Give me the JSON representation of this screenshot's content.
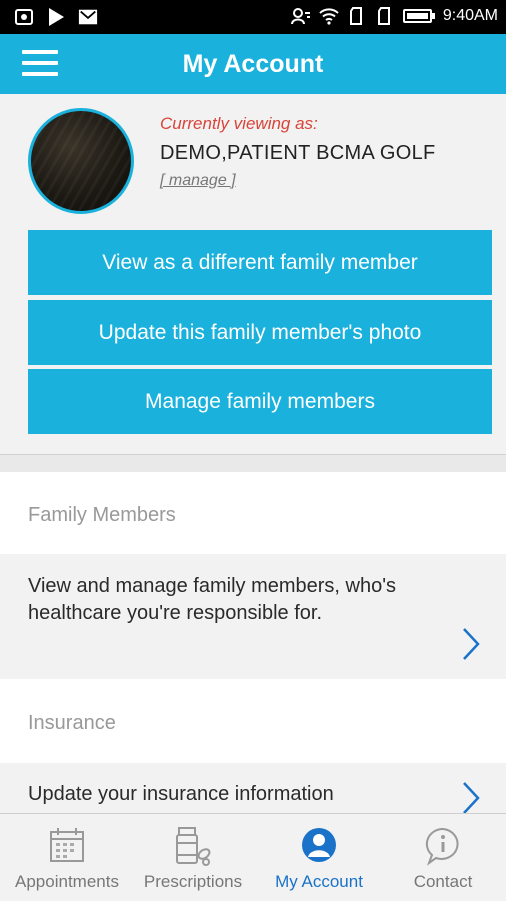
{
  "statusbar": {
    "time": "9:40AM"
  },
  "header": {
    "title": "My Account"
  },
  "profile": {
    "viewing_label": "Currently viewing as:",
    "name": "DEMO,PATIENT BCMA GOLF",
    "manage_label": "[ manage ]"
  },
  "actions": [
    {
      "label": "View as a different family member"
    },
    {
      "label": "Update this family member's photo"
    },
    {
      "label": "Manage family members"
    }
  ],
  "sections": [
    {
      "title": "Family Members",
      "description": "View and manage family members, who's healthcare you're responsible for."
    },
    {
      "title": "Insurance",
      "description": "Update your insurance information"
    }
  ],
  "tabs": [
    {
      "label": "Appointments",
      "icon": "calendar-icon"
    },
    {
      "label": "Prescriptions",
      "icon": "pill-bottle-icon"
    },
    {
      "label": "My Account",
      "icon": "user-icon",
      "active": true
    },
    {
      "label": "Contact",
      "icon": "info-chat-icon"
    }
  ],
  "colors": {
    "primary": "#1ab1dc",
    "active_tab": "#1a73c9",
    "alert_text": "#d9443a"
  }
}
